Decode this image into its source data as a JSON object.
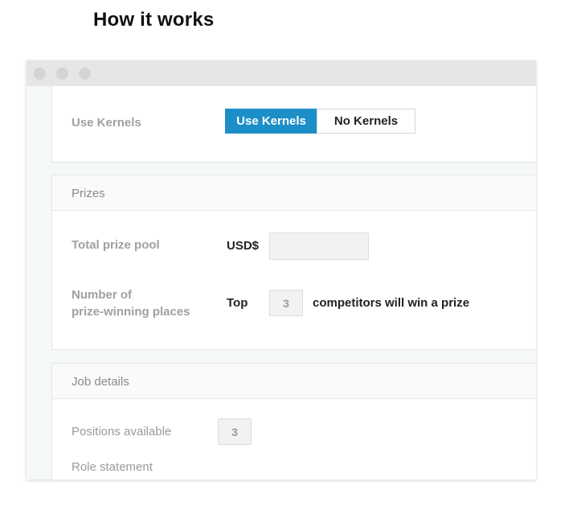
{
  "heading": "How it works",
  "kernels": {
    "label": "Use Kernels",
    "option_on": "Use Kernels",
    "option_off": "No Kernels"
  },
  "prizes": {
    "section_title": "Prizes",
    "pool_label": "Total prize pool",
    "currency": "USD$",
    "pool_value": "",
    "places_label_line1": "Number of",
    "places_label_line2": "prize-winning places",
    "top_prefix": "Top",
    "places_value": "3",
    "places_suffix": "competitors will win a prize"
  },
  "job": {
    "section_title": "Job details",
    "positions_label": "Positions available",
    "positions_value": "3",
    "role_label": "Role statement"
  },
  "colors": {
    "accent": "#1d8fc8",
    "titlebar": "#e6e6e6"
  }
}
